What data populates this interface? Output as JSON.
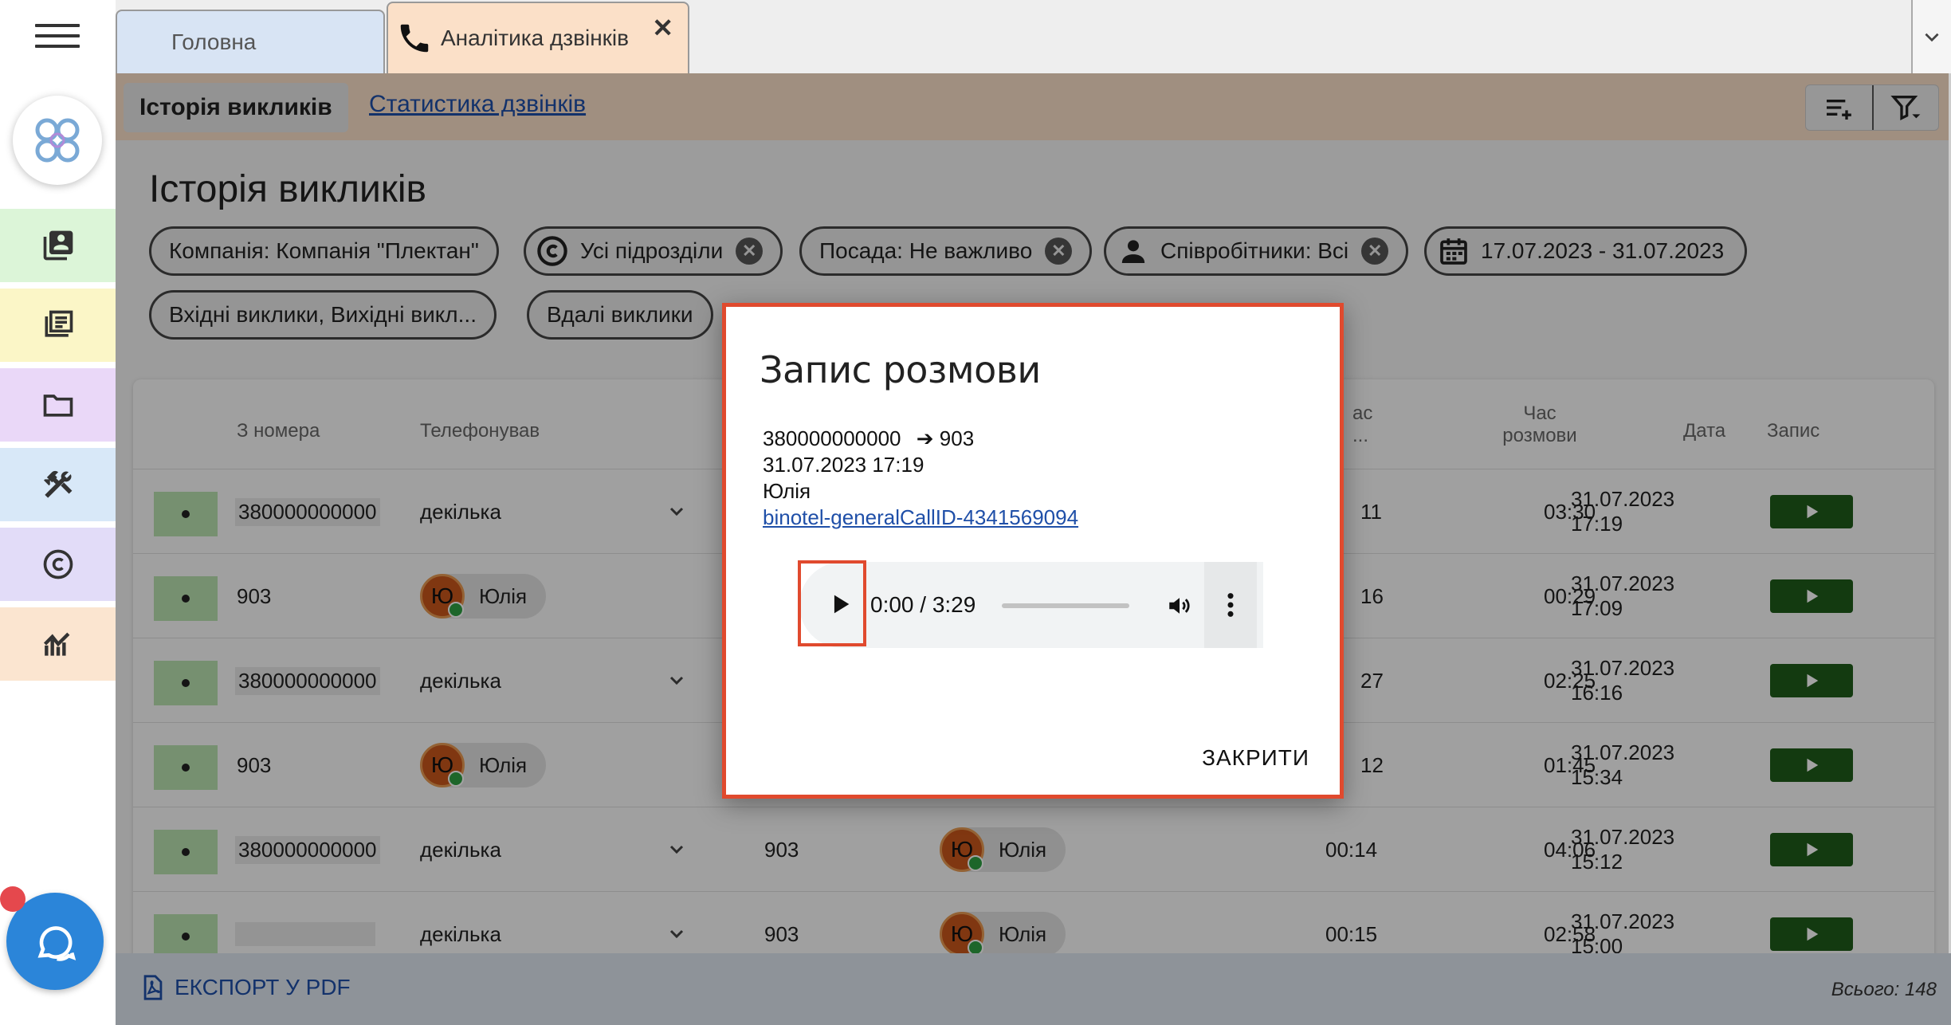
{
  "tabs": {
    "home_label": "Головна",
    "analytics_label": "Аналітика дзвінків",
    "close_glyph": "✕"
  },
  "subnav": {
    "active_label": "Історія викликів",
    "link_label": "Статистика дзвінків"
  },
  "page": {
    "title": "Історія викликів"
  },
  "filters": {
    "company": "Компанія: Компанія \"Плектан\"",
    "divisions": "Усі підрозділи",
    "position": "Посада: Не важливо",
    "employees": "Співробітники: Всі",
    "date_range": "17.07.2023 - 31.07.2023",
    "call_types": "Вхідні виклики, Вихідні викл...",
    "status": "Вдалі виклики"
  },
  "table": {
    "headers": {
      "from": "З номера",
      "caller": "Телефонував",
      "wait_top": "ас",
      "wait_bottom": "...",
      "talk_top": "Час",
      "talk_bottom": "розмови",
      "date": "Дата",
      "record": "Запис"
    },
    "rows": [
      {
        "from": "380000000000",
        "caller": "декілька",
        "wait": "11",
        "talk": "03:30",
        "date": "31.07.2023 17:19"
      },
      {
        "from": "903",
        "caller": "Юлія",
        "avatar": "Ю",
        "wait": "16",
        "talk": "00:29",
        "date": "31.07.2023 17:09"
      },
      {
        "from": "380000000000",
        "caller": "декілька",
        "wait": "27",
        "talk": "02:25",
        "date": "31.07.2023 16:16"
      },
      {
        "from": "903",
        "caller": "Юлія",
        "avatar": "Ю",
        "wait": "12",
        "talk": "01:45",
        "date": "31.07.2023 15:34"
      },
      {
        "from": "380000000000",
        "caller": "декілька",
        "to": "903",
        "to_name": "Юлія",
        "to_avatar": "Ю",
        "wait": "00:14",
        "talk": "04:06",
        "date": "31.07.2023 15:12"
      },
      {
        "from": "",
        "caller": "декілька",
        "to": "903",
        "to_name": "Юлія",
        "to_avatar": "Ю",
        "wait": "00:15",
        "talk": "02:58",
        "date": "31.07.2023 15:00"
      }
    ]
  },
  "footer": {
    "export_label": "ЕКСПОРТ У PDF",
    "total": "Всього: 148"
  },
  "modal": {
    "title": "Запис розмови",
    "route_from": "380000000000",
    "route_arrow": "➔",
    "route_to": "903",
    "datetime": "31.07.2023 17:19",
    "employee": "Юлія",
    "call_id_link": "binotel-generalCallID-4341569094",
    "player_time": "0:00 / 3:29",
    "player_progress": 0,
    "close_label": "ЗАКРИТИ"
  },
  "icons": {
    "menu": "hamburger-icon",
    "contacts": "contacts-book-icon",
    "news": "newspaper-icon",
    "folder": "folder-icon",
    "tools": "tools-icon",
    "copyright": "copyright-icon",
    "analytics": "analytics-chart-icon",
    "chat": "chat-bubble-icon",
    "phone": "phone-icon",
    "pdf": "pdf-file-icon"
  },
  "colors": {
    "sidebar_contacts": "#dcf5d8",
    "sidebar_news": "#fbf6c7",
    "sidebar_folder": "#ead8f8",
    "sidebar_tools": "#d8e8f8",
    "sidebar_copyright": "#e2dcf8",
    "sidebar_analytics": "#fbe5d0",
    "accent_red": "#e04a2e",
    "record_green": "#1f5c1a",
    "link_blue": "#1f4fa8"
  }
}
